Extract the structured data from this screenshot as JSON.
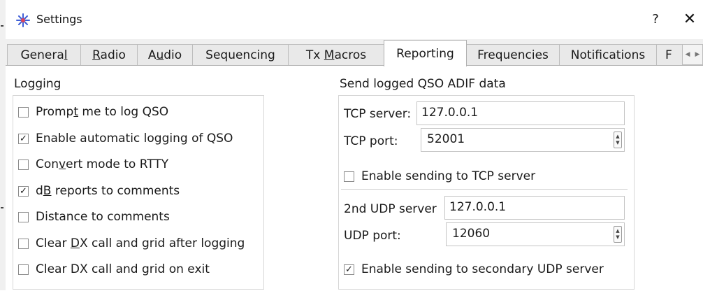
{
  "window": {
    "title": "Settings",
    "help_label": "?",
    "close_label": "✕"
  },
  "tabs": [
    {
      "label": "General",
      "ul": "l"
    },
    {
      "label": "Radio",
      "ul": "R"
    },
    {
      "label": "Audio",
      "ul": "u"
    },
    {
      "label": "Sequencing",
      "ul": ""
    },
    {
      "label": "Tx Macros",
      "ul": "M"
    },
    {
      "label": "Reporting",
      "ul": "",
      "active": true
    },
    {
      "label": "Frequencies",
      "ul": ""
    },
    {
      "label": "Notifications",
      "ul": ""
    },
    {
      "label": "F",
      "ul": ""
    }
  ],
  "logging": {
    "title": "Logging",
    "options": [
      {
        "pre": "Promp",
        "u": "t",
        "post": " me to log QSO",
        "checked": false
      },
      {
        "pre": "Enable automatic logging of QSO",
        "u": "",
        "post": "",
        "checked": true
      },
      {
        "pre": "Con",
        "u": "v",
        "post": "ert mode to RTTY",
        "checked": false
      },
      {
        "pre": "d",
        "u": "B",
        "post": " reports to comments",
        "checked": true
      },
      {
        "pre": "Distance to comments",
        "u": "",
        "post": "",
        "checked": false
      },
      {
        "pre": "Clear ",
        "u": "D",
        "post": "X call and grid after logging",
        "checked": false
      },
      {
        "pre": "Clear DX call and grid on exit",
        "u": "",
        "post": "",
        "checked": false
      }
    ]
  },
  "adif": {
    "title": "Send logged QSO ADIF data",
    "tcp_server_label": "TCP server:",
    "tcp_server_value": "127.0.0.1",
    "tcp_port_label": "TCP port:",
    "tcp_port_value": "52001",
    "enable_tcp_label": "Enable sending to TCP server",
    "enable_tcp_checked": false,
    "udp_server_label": "2nd UDP server",
    "udp_server_value": "127.0.0.1",
    "udp_port_label": "UDP port:",
    "udp_port_value": "12060",
    "enable_udp_label": "Enable sending to secondary UDP server",
    "enable_udp_checked": true
  },
  "symbols": {
    "check": "✓",
    "up": "▲",
    "down": "▼",
    "left": "◀",
    "right": "▶"
  }
}
